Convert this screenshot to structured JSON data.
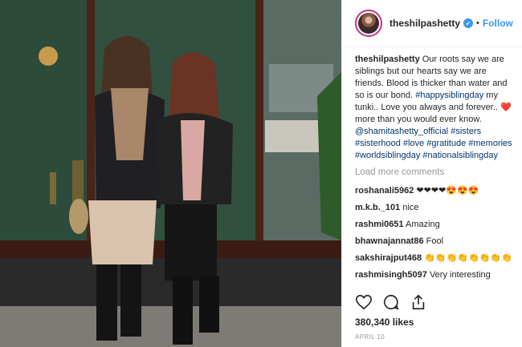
{
  "post": {
    "username": "theshilpashetty",
    "follow_label": "Follow",
    "separator": "•",
    "caption": {
      "username": "theshilpashetty",
      "text_1": "Our roots say we are siblings but our hearts say we are friends. Blood is thicker than water and so is our bond.",
      "tag_1": "#happysiblingday",
      "text_2": "my tunki.. Love you always and forever.. ❤️more than you would ever know.",
      "mention": "@shamitashetty_official",
      "tags_end": "#sisters #sisterhood #love #gratitude #memories #worldsiblingday #nationalsiblingday"
    },
    "load_more_label": "Load more comments",
    "comments": [
      {
        "user": "roshanali5962",
        "text": "❤❤❤❤😍😍😍"
      },
      {
        "user": "m.k.b._101",
        "text": "nice"
      },
      {
        "user": "rashmi0651",
        "text": "Amazing"
      },
      {
        "user": "bhawnajannat86",
        "text": "Fool"
      },
      {
        "user": "sakshirajput468",
        "text": "👏👏👏👏👏👏👏👏"
      },
      {
        "user": "rashmisingh5097",
        "text": "Very interesting"
      }
    ],
    "likes": "380,340 likes",
    "date": "APRIL 10"
  },
  "icons": [
    "verified-badge-icon",
    "heart-icon",
    "comment-icon",
    "share-icon"
  ],
  "colors": {
    "link": "#3897f0",
    "hashtag": "#003569",
    "muted": "#999999"
  }
}
